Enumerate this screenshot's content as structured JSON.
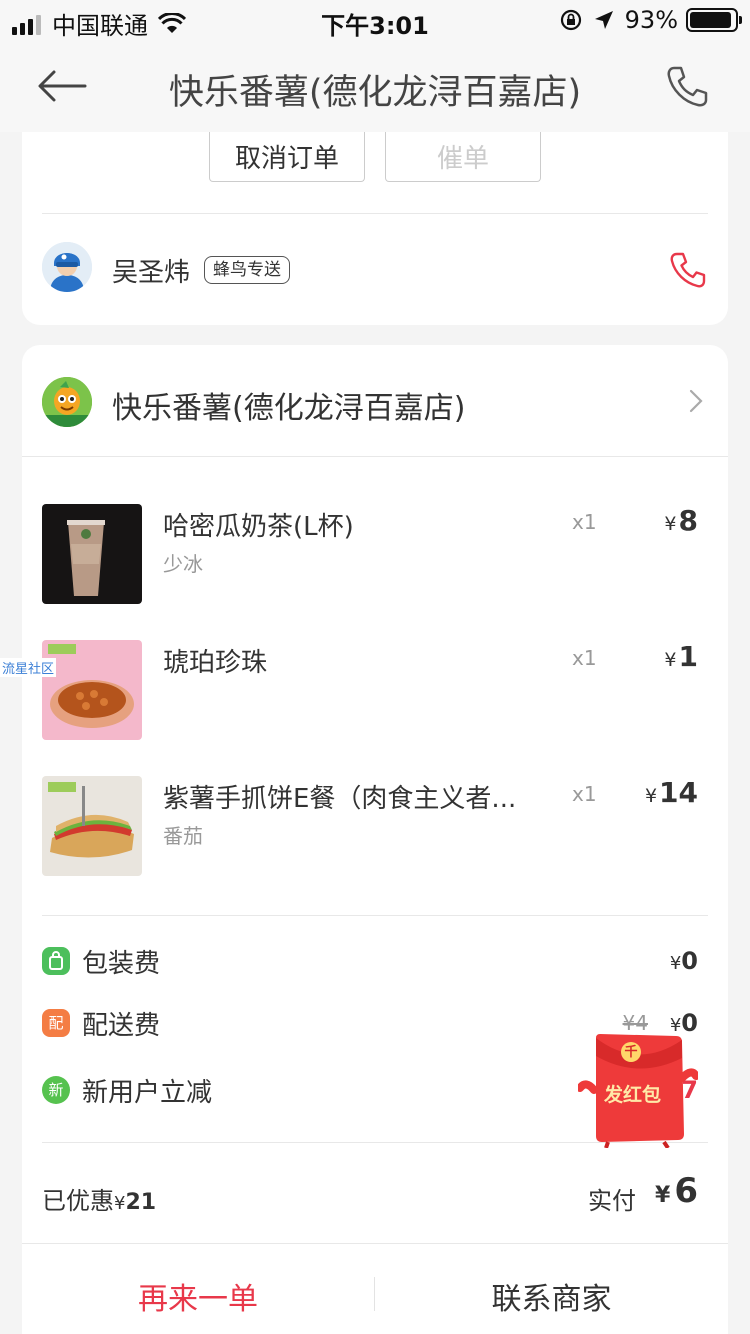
{
  "status_bar": {
    "carrier": "中国联通",
    "time": "下午3:01",
    "battery": "93%",
    "battery_level": 0.93
  },
  "navbar": {
    "title": "快乐番薯(德化龙浔百嘉店)"
  },
  "order_actions": {
    "cancel_label": "取消订单",
    "urge_label": "催单"
  },
  "rider": {
    "name": "吴圣炜",
    "tag": "蜂鸟专送"
  },
  "shop": {
    "name": "快乐番薯(德化龙浔百嘉店)"
  },
  "items": [
    {
      "name": "哈密瓜奶茶(L杯)",
      "spec": "少冰",
      "qty": "x1",
      "currency": "¥",
      "price": "8"
    },
    {
      "name": "琥珀珍珠",
      "spec": "",
      "qty": "x1",
      "currency": "¥",
      "price": "1"
    },
    {
      "name": "紫薯手抓饼E餐（肉食主义者...",
      "spec": "番茄",
      "qty": "x1",
      "currency": "¥",
      "price": "14"
    }
  ],
  "fees": {
    "packing": {
      "icon_text": "",
      "label": "包装费",
      "currency": "¥",
      "value": "0",
      "icon_color": "#4cbf5c"
    },
    "delivery": {
      "icon_text": "配",
      "label": "配送费",
      "original": "¥4",
      "currency": "¥",
      "value": "0",
      "icon_color": "#f47d44"
    },
    "new_user": {
      "icon_text": "新",
      "label": "新用户立减",
      "value": "17",
      "icon_color": "#56c24f"
    }
  },
  "summary": {
    "saved_label": "已优惠",
    "saved_currency": "¥",
    "saved_value": "21",
    "paid_label": "实付",
    "paid_currency": "¥",
    "paid_value": "6"
  },
  "bottom_actions": {
    "reorder_label": "再来一单",
    "contact_label": "联系商家"
  },
  "watermark": "流星社区",
  "red_packet": {
    "label": "发红包",
    "symbol": "千"
  },
  "colors": {
    "accent_red": "#e8384a",
    "background": "#f4f4f4"
  }
}
